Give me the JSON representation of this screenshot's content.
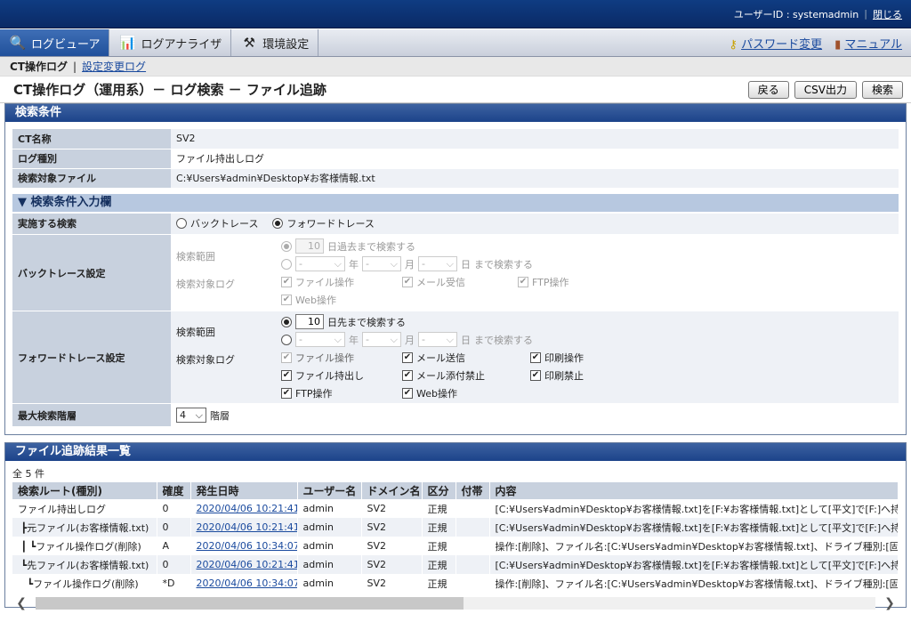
{
  "topbar": {
    "user_label": "ユーザーID : systemadmin",
    "sep": "|",
    "close": "閉じる"
  },
  "menubar": {
    "tabs": [
      {
        "label": "ログビューア",
        "icon": "magnifier-icon"
      },
      {
        "label": "ログアナライザ",
        "icon": "bar-chart-icon"
      },
      {
        "label": "環境設定",
        "icon": "tools-icon"
      }
    ],
    "password": "パスワード変更",
    "manual": "マニュアル"
  },
  "subnav": {
    "current": "CT操作ログ",
    "sep": "|",
    "link": "設定変更ログ"
  },
  "page": {
    "title": "CT操作ログ（運用系）－ ログ検索 － ファイル追跡",
    "back": "戻る",
    "csv": "CSV出力",
    "search": "検索"
  },
  "conditions": {
    "header": "検索条件",
    "rows": [
      {
        "label": "CT名称",
        "value": "SV2"
      },
      {
        "label": "ログ種別",
        "value": "ファイル持出しログ"
      },
      {
        "label": "検索対象ファイル",
        "value": "C:¥Users¥admin¥Desktop¥お客様情報.txt"
      }
    ]
  },
  "input": {
    "header": "▼ 検索条件入力欄",
    "exec_label": "実施する検索",
    "backtrace_opt": "バックトレース",
    "forward_opt": "フォワードトレース",
    "backtrace": {
      "label": "バックトレース設定",
      "range_label": "検索範囲",
      "days": "10",
      "days_text": "日過去まで検索する",
      "dash": "-",
      "year": "年",
      "month": "月",
      "day": "日",
      "until": "まで検索する",
      "target_label": "検索対象ログ",
      "checks": [
        "ファイル操作",
        "メール受信",
        "FTP操作",
        "Web操作"
      ]
    },
    "forward": {
      "label": "フォワードトレース設定",
      "range_label": "検索範囲",
      "days": "10",
      "days_text": "日先まで検索する",
      "dash": "-",
      "year": "年",
      "month": "月",
      "day": "日",
      "until": "まで検索する",
      "target_label": "検索対象ログ",
      "checks": [
        "ファイル操作",
        "メール送信",
        "印刷操作",
        "ファイル持出し",
        "メール添付禁止",
        "印刷禁止",
        "FTP操作",
        "Web操作"
      ]
    },
    "depth_label": "最大検索階層",
    "depth_value": "4",
    "depth_unit": "階層"
  },
  "results": {
    "header": "ファイル追跡結果一覧",
    "count": "全 5 件",
    "columns": [
      "検索ルート(種別)",
      "確度",
      "発生日時",
      "ユーザー名",
      "ドメイン名",
      "区分",
      "付帯",
      "内容"
    ],
    "rows": [
      [
        "ファイル持出しログ",
        "0",
        "2020/04/06 10:21:41",
        "admin",
        "SV2",
        "正規",
        "",
        "[C:¥Users¥admin¥Desktop¥お客様情報.txt]を[F:¥お客様情報.txt]として[平文]で[F:]へ持出"
      ],
      [
        " ┣元ファイル(お客様情報.txt)",
        "0",
        "2020/04/06 10:21:41",
        "admin",
        "SV2",
        "正規",
        "",
        "[C:¥Users¥admin¥Desktop¥お客様情報.txt]を[F:¥お客様情報.txt]として[平文]で[F:]へ持出"
      ],
      [
        " ┃ ┗ファイル操作ログ(削除)",
        "A",
        "2020/04/06 10:34:07",
        "admin",
        "SV2",
        "正規",
        "",
        "操作:[削除]、ファイル名:[C:¥Users¥admin¥Desktop¥お客様情報.txt]、ドライブ種別:[固定"
      ],
      [
        " ┗先ファイル(お客様情報.txt)",
        "0",
        "2020/04/06 10:21:41",
        "admin",
        "SV2",
        "正規",
        "",
        "[C:¥Users¥admin¥Desktop¥お客様情報.txt]を[F:¥お客様情報.txt]として[平文]で[F:]へ持出"
      ],
      [
        "   ┗ファイル操作ログ(削除)",
        "*D",
        "2020/04/06 10:34:07",
        "admin",
        "SV2",
        "正規",
        "",
        "操作:[削除]、ファイル名:[C:¥Users¥admin¥Desktop¥お客様情報.txt]、ドライブ種別:[固定"
      ]
    ]
  },
  "colors": {
    "header_dark": "#0a2a66",
    "accent": "#21509b",
    "label_bg": "#c8d1de"
  }
}
